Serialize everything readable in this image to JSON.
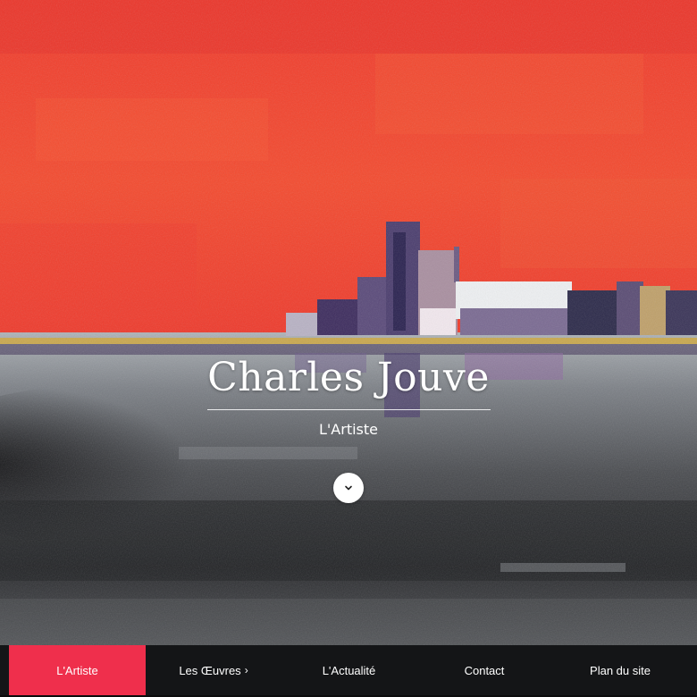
{
  "hero": {
    "title": "Charles Jouve",
    "subtitle": "L'Artiste",
    "scroll_icon": "chevron-down-icon",
    "colors": {
      "sky": "#f1422d",
      "water": "#5e6064",
      "gold_line": "#c9a84e",
      "dark": "#1b1c1e"
    }
  },
  "nav": {
    "items": [
      {
        "label": "L'Artiste",
        "active": true
      },
      {
        "label": "Les Œuvres",
        "arrow": "›",
        "active": false
      },
      {
        "label": "L'Actualité",
        "active": false
      },
      {
        "label": "Contact",
        "active": false
      },
      {
        "label": "Plan du site",
        "active": false
      }
    ],
    "accent": "#ef2f4c"
  }
}
